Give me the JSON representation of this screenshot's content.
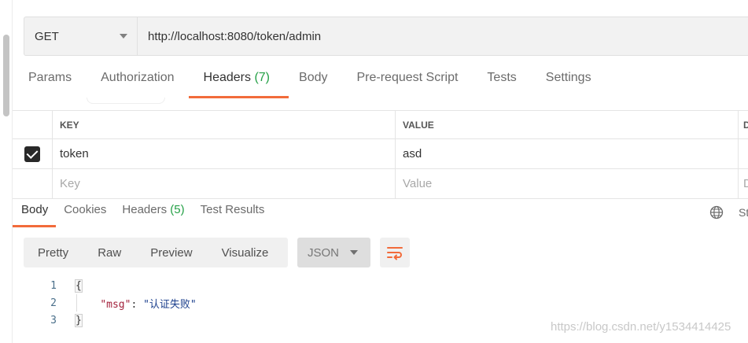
{
  "request": {
    "method": "GET",
    "url": "http://localhost:8080/token/admin"
  },
  "request_tabs": [
    {
      "label": "Params"
    },
    {
      "label": "Authorization"
    },
    {
      "label": "Headers",
      "count": "(7)"
    },
    {
      "label": "Body"
    },
    {
      "label": "Pre-request Script"
    },
    {
      "label": "Tests"
    },
    {
      "label": "Settings"
    }
  ],
  "headers_table": {
    "columns": [
      "KEY",
      "VALUE",
      "D"
    ],
    "rows": [
      {
        "checked": true,
        "key": "token",
        "value": "asd"
      }
    ],
    "new_row": {
      "key_placeholder": "Key",
      "value_placeholder": "Value",
      "desc_placeholder": "D"
    }
  },
  "response_tabs": [
    {
      "label": "Body"
    },
    {
      "label": "Cookies"
    },
    {
      "label": "Headers",
      "count": "(5)"
    },
    {
      "label": "Test Results"
    }
  ],
  "response_status_label": "St",
  "view_modes": [
    "Pretty",
    "Raw",
    "Preview",
    "Visualize"
  ],
  "format": "JSON",
  "body_lines": [
    {
      "no": "1",
      "open": "{"
    },
    {
      "no": "2",
      "key": "\"msg\"",
      "colon": ": ",
      "value": "\"认证失败\""
    },
    {
      "no": "3",
      "close": "}"
    }
  ],
  "watermark": "https://blog.csdn.net/y1534414425",
  "colors": {
    "accent": "#f26b3a",
    "count_green": "#24a046"
  }
}
